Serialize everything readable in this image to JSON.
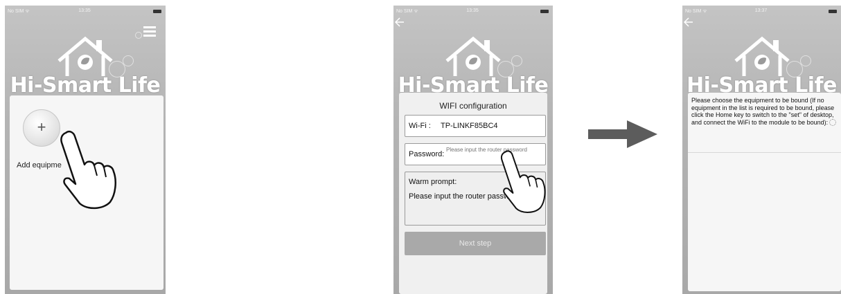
{
  "colors": {
    "screen_background": "#b8b8b8",
    "panel": "#f6f6f6",
    "button_disabled": "#a9a9a9",
    "arrow": "#5c5c5c"
  },
  "screen1": {
    "status": {
      "carrier": "No SIM ᯤ",
      "time": "13:35"
    },
    "logo": "Hi-Smart Life",
    "menu_icon": "hamburger-menu-icon",
    "add_button_symbol": "+",
    "add_label": "Add equipme"
  },
  "transition_arrow": "right-arrow-icon",
  "screen2": {
    "status": {
      "carrier": "No SIM ᯤ",
      "time": "13:35"
    },
    "back_icon": "back-arrow-icon",
    "logo": "Hi-Smart Life",
    "title": "WIFI configuration",
    "wifi_label": "Wi-Fi :",
    "wifi_value": "TP-LINKF85BC4",
    "password_label": "Password:",
    "password_placeholder": "Please input the router password",
    "prompt_title": "Warm prompt:",
    "prompt_text": "Please input the router password",
    "next_button": "Next step"
  },
  "screen3": {
    "status": {
      "carrier": "No SIM ᯤ",
      "time": "13:37"
    },
    "back_icon": "back-arrow-icon",
    "logo": "Hi-Smart Life",
    "instructions": "Please choose the equipment to be bound (If no equipment in the list is required to be bound, please click the Home key to switch to the \"set\" of desktop, and connect the WiFi to the module to be bound):"
  }
}
